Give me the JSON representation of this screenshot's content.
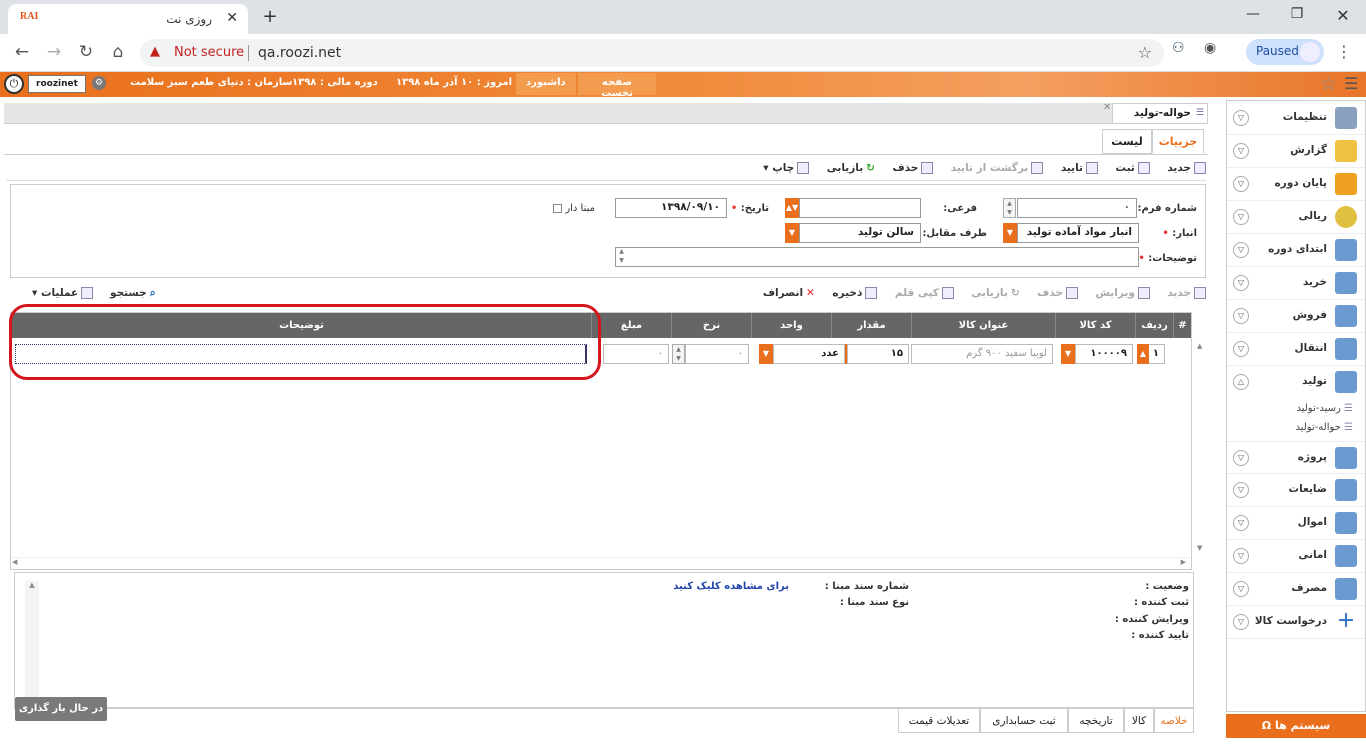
{
  "browser": {
    "tab_title": "روزی نت",
    "tab_logo": "RAI",
    "address_warning": "Not secure",
    "url": "qa.roozi.net",
    "profile_status": "Paused"
  },
  "header": {
    "username": "roozinet",
    "organization_label": "سازمان :",
    "organization_value": "دنیای طعم سبز سلامت",
    "fiscal_label": "دوره مالی :",
    "fiscal_value": "۱۳۹۸",
    "today_label": "امروز :",
    "today_value": "۱۰ آذر ماه ۱۳۹۸",
    "dashboard_button": "داشبورد",
    "home_button": "صفحه نخست",
    "system_button": "سیستم ها"
  },
  "sidebar": {
    "items": [
      {
        "label": "تنظیمات",
        "icon": "settings-icon"
      },
      {
        "label": "گزارش",
        "icon": "report-icon"
      },
      {
        "label": "پایان دوره",
        "icon": "period-end-icon"
      },
      {
        "label": "ریالی",
        "icon": "currency-icon"
      },
      {
        "label": "ابتدای دوره",
        "icon": "period-start-icon"
      },
      {
        "label": "خرید",
        "icon": "purchase-icon"
      },
      {
        "label": "فروش",
        "icon": "sale-icon"
      },
      {
        "label": "انتقال",
        "icon": "transfer-icon"
      },
      {
        "label": "تولید",
        "icon": "production-icon"
      },
      {
        "label": "پروژه",
        "icon": "project-icon"
      },
      {
        "label": "ضایعات",
        "icon": "waste-icon"
      },
      {
        "label": "اموال",
        "icon": "assets-icon"
      },
      {
        "label": "امانی",
        "icon": "trust-icon"
      },
      {
        "label": "مصرف",
        "icon": "consumption-icon"
      },
      {
        "label": "درخواست کالا",
        "icon": "plus-icon"
      }
    ],
    "production_subitems": [
      "رسید-تولید",
      "حواله-تولید"
    ]
  },
  "page": {
    "tab_title": "حواله-تولید",
    "subtab_details": "جزییات",
    "subtab_list": "لیست"
  },
  "toolbar": {
    "new": "جدید",
    "save": "ثبت",
    "approve": "تایید",
    "unapprove": "برگشت از تایید",
    "delete": "حذف",
    "refresh": "بازیابی",
    "print": "چاپ"
  },
  "form": {
    "form_number_label": "شماره فرم:",
    "form_number_value": "۰",
    "sub_label": "فرعی:",
    "sub_value": "",
    "date_label": "تاریخ:",
    "date_value": "۱۳۹۸/۰۹/۱۰",
    "has_base_label": "مبنا دار",
    "warehouse_label": "انبار:",
    "warehouse_value": "انبار مواد آماده تولید",
    "counterparty_label": "طرف مقابل:",
    "counterparty_value": "سالن تولید",
    "description_label": "توضیحات:"
  },
  "grid_toolbar": {
    "new": "جدید",
    "edit": "ویرایش",
    "delete": "حذف",
    "refresh": "بازیابی",
    "copy": "کپی قلم",
    "save": "ذخیره",
    "cancel": "انصراف",
    "search": "جستجو",
    "operations": "عملیات"
  },
  "grid": {
    "columns": [
      "#",
      "ردیف",
      "کد کالا",
      "عنوان کالا",
      "مقدار",
      "واحد",
      "نرخ",
      "مبلغ",
      "توضیحات"
    ],
    "rows": [
      {
        "row": "۱",
        "code": "۱۰۰۰۰۹",
        "title": "لوبیا سفید ۹۰۰ گرم",
        "qty": "۱۵",
        "unit": "عدد",
        "rate": "۰",
        "amount": "۰",
        "desc": ""
      }
    ]
  },
  "info": {
    "status_label": "وضعیت :",
    "creator_label": "ثبت کننده :",
    "editor_label": "ویرایش کننده :",
    "approver_label": "تایید کننده :",
    "base_doc_number_label": "شماره سند مبنا :",
    "base_doc_type_label": "نوع سند مبنا :",
    "view_link": "برای مشاهده کلیک کنید"
  },
  "bottom_tabs": [
    "خلاصه",
    "کالا",
    "تاریخچه",
    "ثبت حسابداری",
    "تعدیلات قیمت"
  ],
  "loading_text": "در حال بار گذاری ..."
}
